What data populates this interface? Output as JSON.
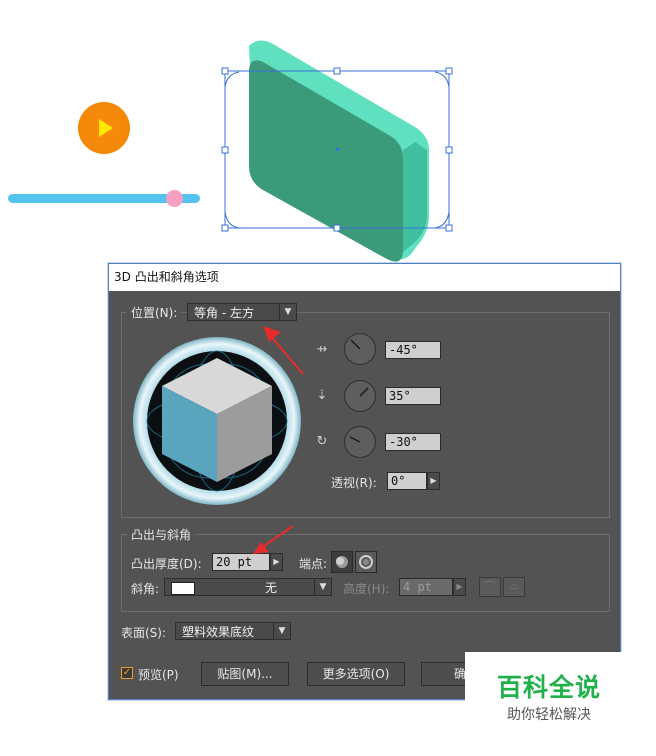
{
  "dialog": {
    "title": "3D 凸出和斜角选项",
    "position": {
      "label": "位置(N):",
      "value": "等角 - 左方"
    },
    "rotation": {
      "x": "-45°",
      "y": "35°",
      "z": "-30°"
    },
    "perspective": {
      "label": "透视(R):",
      "value": "0°"
    },
    "extrude": {
      "group_label": "凸出与斜角",
      "depth_label": "凸出厚度(D):",
      "depth_value": "20 pt",
      "cap_label": "端点:",
      "bevel_label": "斜角:",
      "bevel_value": "无",
      "height_label": "高度(H):",
      "height_value": "4 pt"
    },
    "surface": {
      "label": "表面(S):",
      "value": "塑料效果底纹"
    },
    "buttons": {
      "preview_label": "预览(P)",
      "preview_checked": true,
      "map_art": "贴图(M)...",
      "more_options": "更多选项(O)",
      "ok": "确"
    }
  },
  "watermark": {
    "title": "百科全说",
    "subtitle": "助你轻松解决"
  },
  "colors": {
    "play_button": "#f58a0a",
    "play_triangle": "#ffe800",
    "slider_track": "#55c3f0",
    "slider_knob": "#f6a0c4",
    "shape_face": "#3a9a7a",
    "shape_side": "#5fe0bf",
    "selection": "#3a6fd8",
    "arrow": "#e82b2b",
    "watermark_green": "#21b14b"
  }
}
